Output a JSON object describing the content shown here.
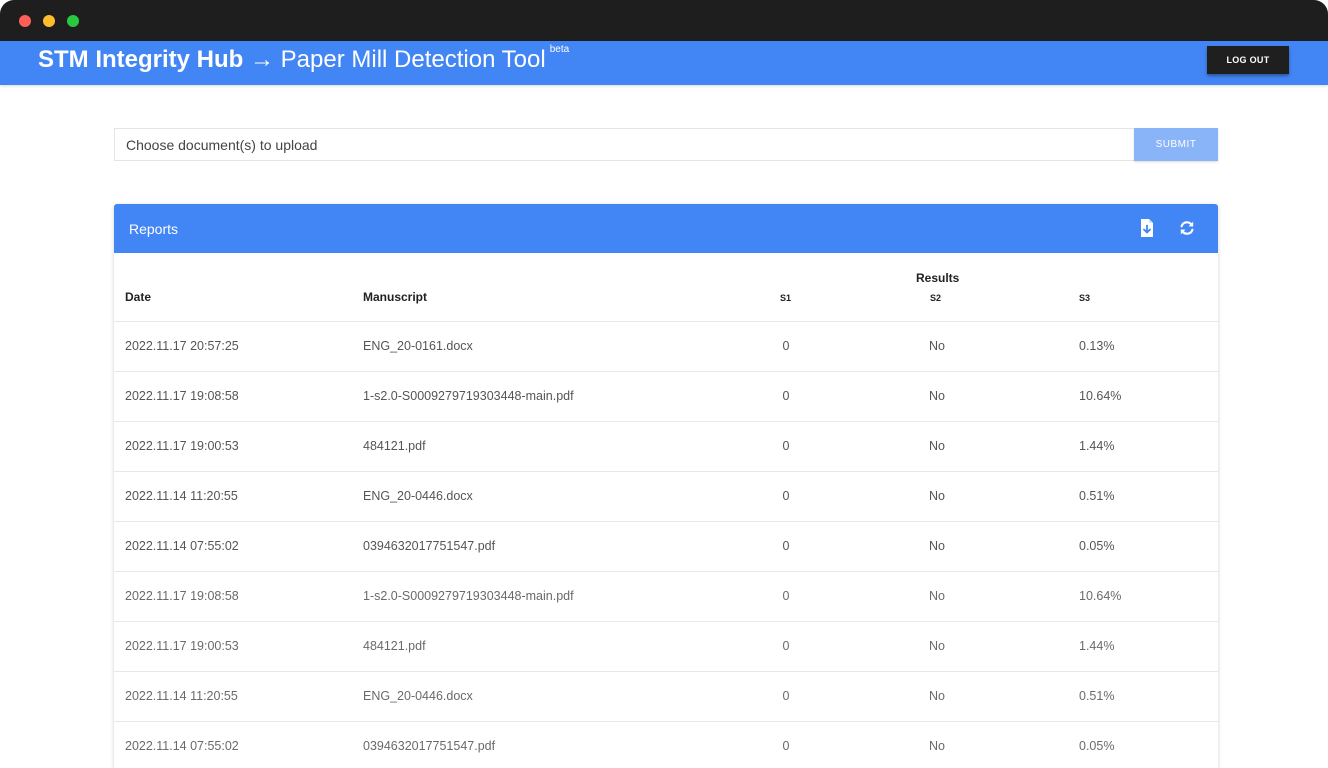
{
  "app": {
    "brand": "STM Integrity Hub",
    "arrow": "→",
    "tool_name": "Paper Mill Detection Tool",
    "badge": "beta",
    "logout_label": "LOG OUT"
  },
  "upload": {
    "placeholder": "Choose document(s) to upload",
    "submit_label": "SUBMIT"
  },
  "reports": {
    "title": "Reports",
    "columns": {
      "date": "Date",
      "manuscript": "Manuscript",
      "results_group": "Results",
      "s1": "S1",
      "s2": "S2",
      "s3": "S3"
    },
    "rows": [
      {
        "date": "2022.11.17 20:57:25",
        "manuscript": "ENG_20-0161.docx",
        "s1": "0",
        "s2": "No",
        "s3": "0.13%"
      },
      {
        "date": "2022.11.17 19:08:58",
        "manuscript": "1-s2.0-S0009279719303448-main.pdf",
        "s1": "0",
        "s2": "No",
        "s3": "10.64%"
      },
      {
        "date": "2022.11.17 19:00:53",
        "manuscript": "484121.pdf",
        "s1": "0",
        "s2": "No",
        "s3": "1.44%"
      },
      {
        "date": "2022.11.14 11:20:55",
        "manuscript": "ENG_20-0446.docx",
        "s1": "0",
        "s2": "No",
        "s3": "0.51%"
      },
      {
        "date": "2022.11.14 07:55:02",
        "manuscript": "0394632017751547.pdf",
        "s1": "0",
        "s2": "No",
        "s3": "0.05%"
      },
      {
        "date": "2022.11.17 19:08:58",
        "manuscript": "1-s2.0-S0009279719303448-main.pdf",
        "s1": "0",
        "s2": "No",
        "s3": "10.64%"
      },
      {
        "date": "2022.11.17 19:00:53",
        "manuscript": "484121.pdf",
        "s1": "0",
        "s2": "No",
        "s3": "1.44%"
      },
      {
        "date": "2022.11.14 11:20:55",
        "manuscript": "ENG_20-0446.docx",
        "s1": "0",
        "s2": "No",
        "s3": "0.51%"
      },
      {
        "date": "2022.11.14 07:55:02",
        "manuscript": "0394632017751547.pdf",
        "s1": "0",
        "s2": "No",
        "s3": "0.05%"
      }
    ]
  },
  "icons": {
    "download": "file-download-icon",
    "refresh": "refresh-icon"
  },
  "colors": {
    "primary": "#4285f4",
    "submit": "#8ab4f8",
    "logout": "#1f1f1f"
  }
}
